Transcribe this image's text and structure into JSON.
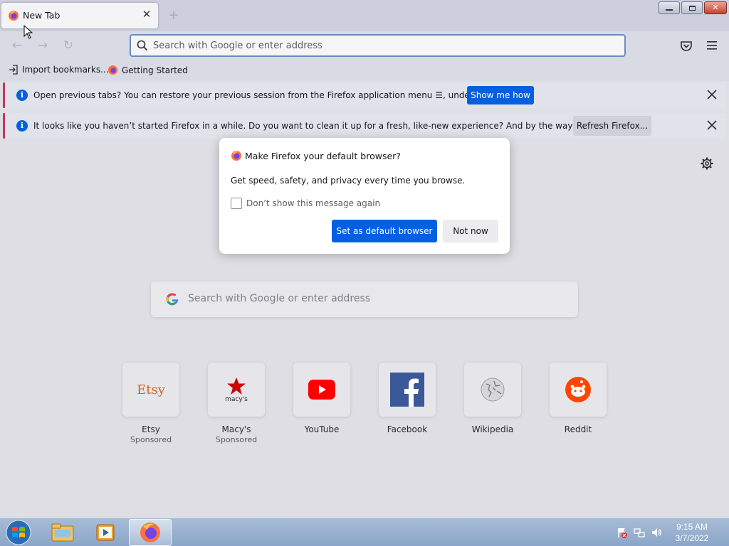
{
  "tab": {
    "title": "New Tab"
  },
  "urlbar": {
    "placeholder": "Search with Google or enter address"
  },
  "bookmarks": [
    {
      "label": "Import bookmarks...",
      "icon": "import-icon"
    },
    {
      "label": "Getting Started",
      "icon": "firefox-icon"
    }
  ],
  "notifications": [
    {
      "message": "Open previous tabs? You can restore your previous session from the Firefox application menu ☰, under History.",
      "button": "Show me how"
    },
    {
      "message": "It looks like you haven’t started Firefox in a while. Do you want to clean it up for a fresh, like-new experience? And by the way, welcome back!",
      "button": "Refresh Firefox..."
    }
  ],
  "modal": {
    "title": "Make Firefox your default browser?",
    "body": "Get speed, safety, and privacy every time you browse.",
    "checkbox_label": "Don’t show this message again",
    "primary_button": "Set as default browser",
    "secondary_button": "Not now"
  },
  "content_search": {
    "placeholder": "Search with Google or enter address"
  },
  "top_sites": [
    {
      "name": "Etsy",
      "sponsored": "Sponsored",
      "logo_text": "Etsy"
    },
    {
      "name": "Macy's",
      "sponsored": "Sponsored",
      "logo_text": "macy's"
    },
    {
      "name": "YouTube",
      "sponsored": ""
    },
    {
      "name": "Facebook",
      "sponsored": ""
    },
    {
      "name": "Wikipedia",
      "sponsored": ""
    },
    {
      "name": "Reddit",
      "sponsored": ""
    }
  ],
  "clock": {
    "time": "9:15 AM",
    "date": "3/7/2022"
  },
  "colors": {
    "accent": "#0060df",
    "notification_border": "#c8345a"
  }
}
